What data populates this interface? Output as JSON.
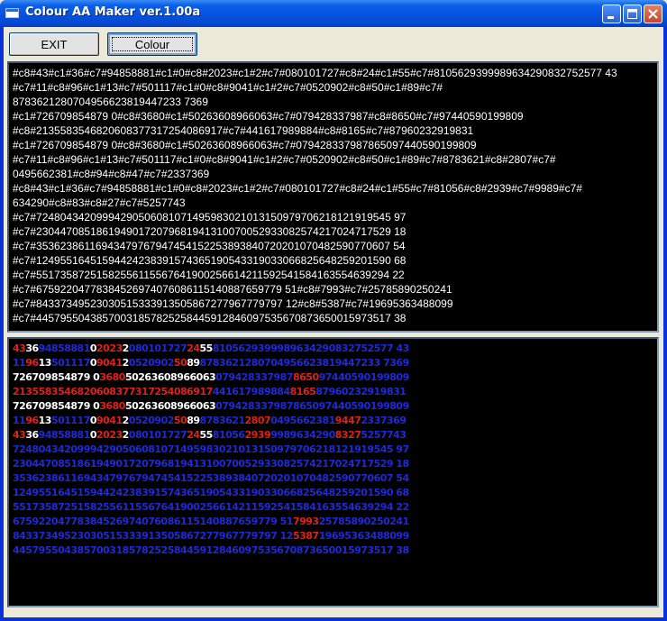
{
  "window": {
    "title": "Colour AA Maker ver.1.00a",
    "icons": [
      "app-icon",
      "minimize-icon",
      "maximize-icon",
      "close-icon"
    ]
  },
  "toolbar": {
    "exit_label": "EXIT",
    "colour_label": "Colour"
  },
  "source_lines": [
    "#c8#43#c1#36#c7#94858881#c1#0#c8#2023#c1#2#c7#080101727#c8#24#c1#55#c7#8105629399989634290832752577 43",
    "#c7#11#c8#96#c1#13#c7#501117#c1#0#c8#9041#c1#2#c7#0520902#c8#50#c1#89#c7#",
    "8783621280704956623819447233 7369",
    "#c1#726709854879 0#c8#3680#c1#50263608966063#c7#079428337987#c8#8650#c7#97440590199809",
    "#c8#2135583546820608377317254086917#c7#441617989884#c8#8165#c7#87960232919831",
    "#c1#726709854879 0#c8#3680#c1#50263608966063#c7#079428337987865097440590199809",
    "#c7#11#c8#96#c1#13#c7#501117#c1#0#c8#9041#c1#2#c7#0520902#c8#50#c1#89#c7#8783621#c8#2807#c7#",
    "0495662381#c8#94#c8#47#c7#2337369",
    "#c8#43#c1#36#c7#94858881#c1#0#c8#2023#c1#2#c7#080101727#c8#24#c1#55#c7#81056#c8#2939#c7#9989#c7#",
    "634290#c8#83#c8#27#c7#5257743",
    "#c7#72480434209994290506081071495983021013150979706218121919545 97",
    "#c7#23044708518619490172079681941310070052933082574217024717529 18",
    "#c7#35362386116943479767947454152253893840720201070482590770607 54",
    "#c7#12495516451594424238391574365190543319033066825648259201590 68",
    "#c7#55173587251582556115567641900256614211592541584163554639294 22",
    "#c7#67592204778384526974076086115140887659779 51#c8#7993#c7#25785890250241",
    "#c7#84337349523030515333913505867277967779797 12#c8#5387#c7#19695363488099",
    "#c7#44579550438570031857825258445912846097535670873650015973517 38"
  ],
  "aa_lines": [
    [
      {
        "t": "43",
        "c": "red"
      },
      {
        "t": "36",
        "c": "white"
      },
      {
        "t": "94858881",
        "c": "blue"
      },
      {
        "t": "0",
        "c": "white"
      },
      {
        "t": "2023",
        "c": "red"
      },
      {
        "t": "2",
        "c": "white"
      },
      {
        "t": "080101727",
        "c": "blue"
      },
      {
        "t": "24",
        "c": "red"
      },
      {
        "t": "55",
        "c": "white"
      },
      {
        "t": "8105629399989634290832752577 43",
        "c": "blue"
      }
    ],
    [
      {
        "t": "11",
        "c": "blue"
      },
      {
        "t": "96",
        "c": "red"
      },
      {
        "t": "13",
        "c": "white"
      },
      {
        "t": "501117",
        "c": "blue"
      },
      {
        "t": "0",
        "c": "white"
      },
      {
        "t": "9041",
        "c": "red"
      },
      {
        "t": "2",
        "c": "white"
      },
      {
        "t": "0520902",
        "c": "blue"
      },
      {
        "t": "50",
        "c": "red"
      },
      {
        "t": "89",
        "c": "white"
      },
      {
        "t": "8783621280704956623819447233 7369",
        "c": "blue"
      }
    ],
    [
      {
        "t": "726709854879 0",
        "c": "white"
      },
      {
        "t": "3680",
        "c": "red"
      },
      {
        "t": "50263608966063",
        "c": "white"
      },
      {
        "t": "079428337987",
        "c": "blue"
      },
      {
        "t": "8650",
        "c": "red"
      },
      {
        "t": "97440590199809",
        "c": "blue"
      }
    ],
    [
      {
        "t": "2135583546820608377317254086917",
        "c": "red"
      },
      {
        "t": "441617989884",
        "c": "blue"
      },
      {
        "t": "8165",
        "c": "red"
      },
      {
        "t": "87960232919831",
        "c": "blue"
      }
    ],
    [
      {
        "t": "726709854879 0",
        "c": "white"
      },
      {
        "t": "3680",
        "c": "red"
      },
      {
        "t": "50263608966063",
        "c": "white"
      },
      {
        "t": "079428337987865097440590199809",
        "c": "blue"
      }
    ],
    [
      {
        "t": "11",
        "c": "blue"
      },
      {
        "t": "96",
        "c": "red"
      },
      {
        "t": "13",
        "c": "white"
      },
      {
        "t": "501117",
        "c": "blue"
      },
      {
        "t": "0",
        "c": "white"
      },
      {
        "t": "9041",
        "c": "red"
      },
      {
        "t": "2",
        "c": "white"
      },
      {
        "t": "0520902",
        "c": "blue"
      },
      {
        "t": "50",
        "c": "red"
      },
      {
        "t": "89",
        "c": "white"
      },
      {
        "t": "8783621",
        "c": "blue"
      },
      {
        "t": "2807",
        "c": "red"
      },
      {
        "t": "0495662381",
        "c": "blue"
      },
      {
        "t": "9447",
        "c": "red"
      },
      {
        "t": "2337369",
        "c": "blue"
      }
    ],
    [
      {
        "t": "43",
        "c": "red"
      },
      {
        "t": "36",
        "c": "white"
      },
      {
        "t": "94858881",
        "c": "blue"
      },
      {
        "t": "0",
        "c": "white"
      },
      {
        "t": "2023",
        "c": "red"
      },
      {
        "t": "2",
        "c": "white"
      },
      {
        "t": "080101727",
        "c": "blue"
      },
      {
        "t": "24",
        "c": "red"
      },
      {
        "t": "55",
        "c": "white"
      },
      {
        "t": "81056",
        "c": "blue"
      },
      {
        "t": "2939",
        "c": "red"
      },
      {
        "t": "9989634290",
        "c": "blue"
      },
      {
        "t": "8327",
        "c": "red"
      },
      {
        "t": "5257743",
        "c": "blue"
      }
    ],
    [
      {
        "t": "72480434209994290506081071495983021013150979706218121919545 97",
        "c": "blue"
      }
    ],
    [
      {
        "t": "23044708518619490172079681941310070052933082574217024717529 18",
        "c": "blue"
      }
    ],
    [
      {
        "t": "35362386116943479767947454152253893840720201070482590770607 54",
        "c": "blue"
      }
    ],
    [
      {
        "t": "12495516451594424238391574365190543319033066825648259201590 68",
        "c": "blue"
      }
    ],
    [
      {
        "t": "55173587251582556115567641900256614211592541584163554639294 22",
        "c": "blue"
      }
    ],
    [
      {
        "t": "67592204778384526974076086115140887659779 51",
        "c": "blue"
      },
      {
        "t": "7993",
        "c": "red"
      },
      {
        "t": "25785890250241",
        "c": "blue"
      }
    ],
    [
      {
        "t": "84337349523030515333913505867277967779797 12",
        "c": "blue"
      },
      {
        "t": "5387",
        "c": "red"
      },
      {
        "t": "19695363488099",
        "c": "blue"
      }
    ],
    [
      {
        "t": "44579550438570031857825258445912846097535670873650015973517 38",
        "c": "blue"
      }
    ]
  ],
  "colors": {
    "red": "#e0201c",
    "white": "#ffffff",
    "blue": "#1f2ad6",
    "titlebar": "#0553e0",
    "panel_bg": "#000000"
  }
}
